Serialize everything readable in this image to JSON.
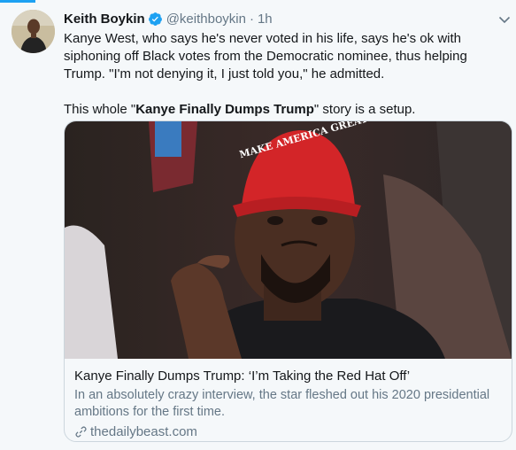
{
  "tweet": {
    "author_name": "Keith Boykin",
    "handle": "@keithboykin",
    "separator": "·",
    "time": "1h",
    "text_line1_part1": "Kanye West, who says he's never voted in his life, says he's ok with siphoning off Black votes from the Democratic nominee, thus helping Trump. \"I'm not denying it, I just told you,\" he admitted.",
    "text2_pre": "This whole \"",
    "text2_bold": "Kanye Finally Dumps Trump",
    "text2_post": "\" story is a setup."
  },
  "card": {
    "title": "Kanye Finally Dumps Trump: ‘I’m Taking the Red Hat Off’",
    "description": "In an absolutely crazy interview, the star fleshed out his 2020 presidential ambitions for the first time.",
    "domain": "thedailybeast.com",
    "hat_text": "MAKE AMERICA GREAT AGAIN"
  },
  "icons": {
    "verified": "verified-badge-icon",
    "more": "chevron-down-icon",
    "link": "link-icon"
  },
  "colors": {
    "accent": "#1da1f2",
    "background": "#f5f8fa",
    "text": "#14171a",
    "secondary": "#657786",
    "border": "#ccd6dd",
    "hat_red": "#d32528"
  }
}
